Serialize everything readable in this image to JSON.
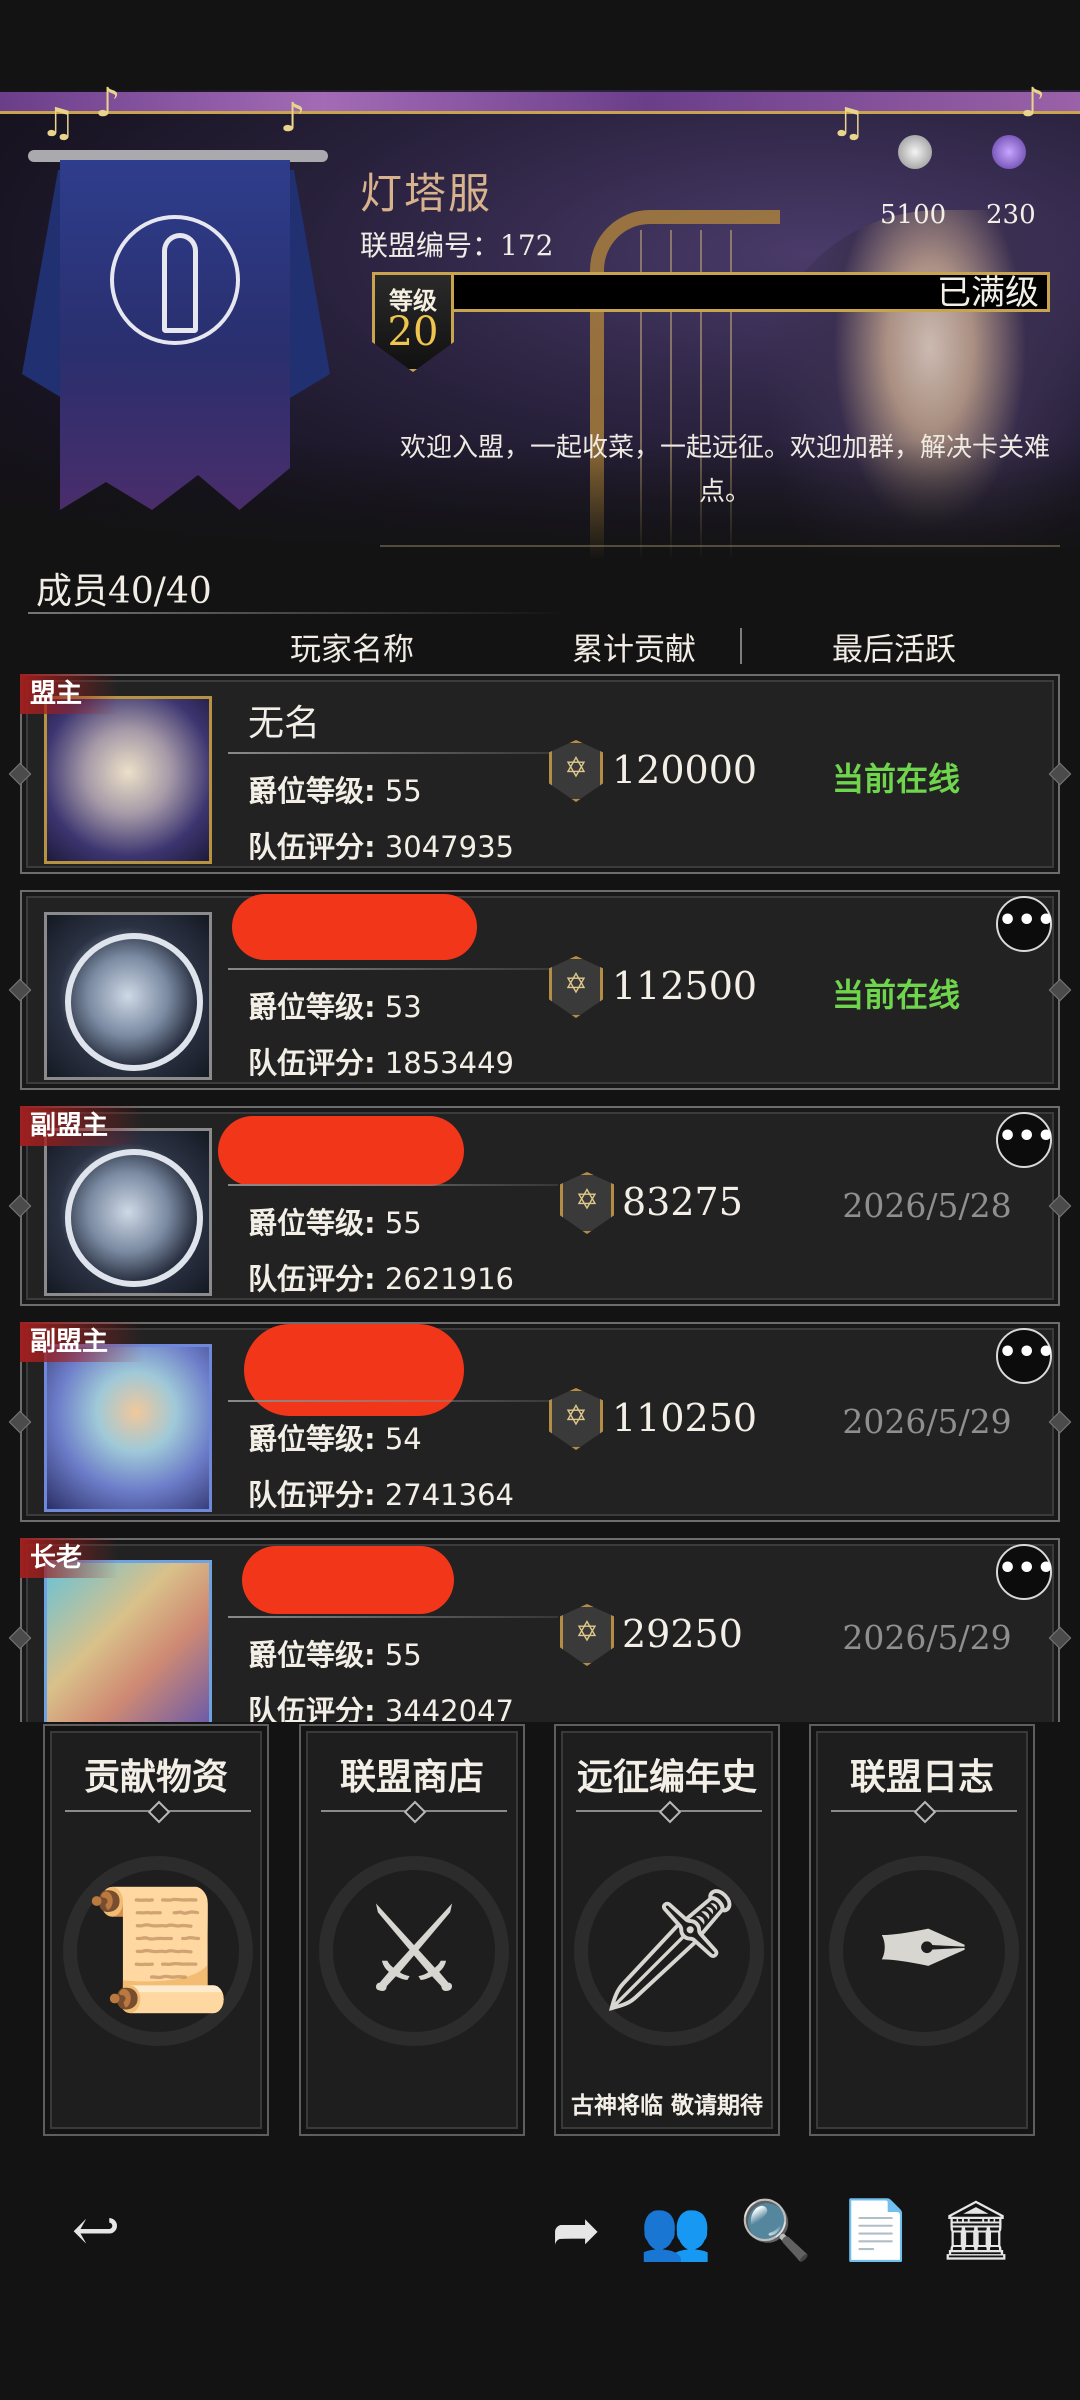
{
  "guild": {
    "name": "灯塔服",
    "id_text": "联盟编号：172",
    "level_label": "等级",
    "level": "20",
    "level_status": "已满级",
    "motto": "欢迎入盟，一起收菜，一起远征。欢迎加群，解决卡关难点。",
    "resources": [
      {
        "icon": "gem-icon",
        "value": "5100"
      },
      {
        "icon": "crystal-icon",
        "value": "230"
      }
    ]
  },
  "members": {
    "count_text": "成员40/40",
    "columns": [
      "玩家名称",
      "累计贡献",
      "最后活跃"
    ],
    "rank_label": "爵位等级:",
    "score_label": "队伍评分:",
    "rows": [
      {
        "role": "盟主",
        "name": "无名",
        "rank": "55",
        "score": "3047935",
        "contribution": "120000",
        "last_active": "当前在线",
        "online": true,
        "avatar": "blonde-portrait"
      },
      {
        "role": "",
        "name": "",
        "rank": "53",
        "score": "1853449",
        "contribution": "112500",
        "last_active": "当前在线",
        "online": true,
        "avatar": "moon-castle"
      },
      {
        "role": "副盟主",
        "name": "",
        "rank": "55",
        "score": "2621916",
        "contribution": "83275",
        "last_active": "2026/5/28",
        "online": false,
        "avatar": "moon-castle"
      },
      {
        "role": "副盟主",
        "name": "",
        "rank": "54",
        "score": "2741364",
        "contribution": "110250",
        "last_active": "2026/5/29",
        "online": false,
        "avatar": "elf-portrait"
      },
      {
        "role": "长老",
        "name": "",
        "rank": "55",
        "score": "3442047",
        "contribution": "29250",
        "last_active": "2026/5/29",
        "online": false,
        "avatar": "rainbow-portrait"
      }
    ],
    "more_label": "•••"
  },
  "features": [
    {
      "title": "贡献物资",
      "icon": "scroll-icon",
      "subtitle": ""
    },
    {
      "title": "联盟商店",
      "icon": "armor-sword-icon",
      "subtitle": ""
    },
    {
      "title": "远征编年史",
      "icon": "crossed-flags-sword-icon",
      "subtitle": "古神将临 敬请期待"
    },
    {
      "title": "联盟日志",
      "icon": "quill-paper-icon",
      "subtitle": ""
    }
  ],
  "bottom_bar": [
    "back-icon",
    "share-icon",
    "members-icon",
    "search-icon",
    "document-icon",
    "bank-icon"
  ],
  "colors": {
    "online": "#6fd54c",
    "gold": "#c9a44f",
    "role_tag": "#a01f1f",
    "redaction": "#f2361a"
  }
}
